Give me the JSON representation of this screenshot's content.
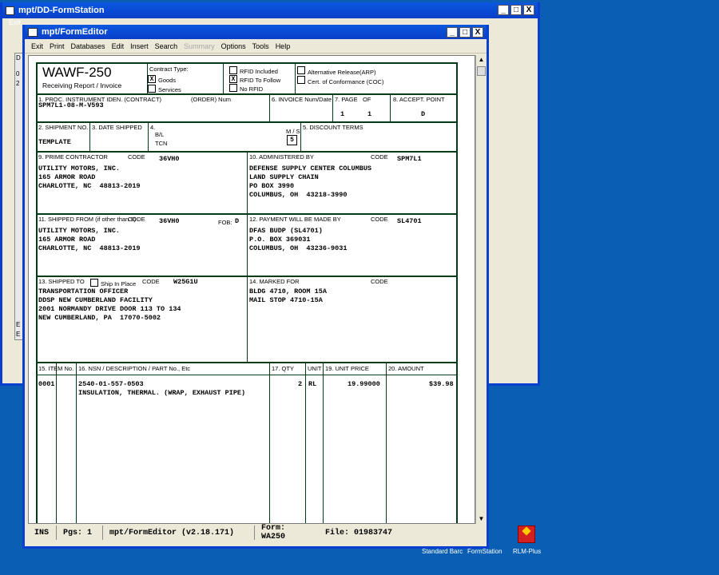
{
  "back_window": {
    "title": "mpt/DD-FormStation",
    "menu_text": "Exit",
    "stub_chars": [
      "D",
      "0",
      "2"
    ],
    "stub_bottom": [
      "E",
      "E"
    ]
  },
  "window": {
    "title": "mpt/FormEditor",
    "minimize": "_",
    "maximize": "□",
    "close": "X"
  },
  "menu": [
    {
      "label": "Exit",
      "disabled": false
    },
    {
      "label": "Print",
      "disabled": false
    },
    {
      "label": "Databases",
      "disabled": false
    },
    {
      "label": "Edit",
      "disabled": false
    },
    {
      "label": "Insert",
      "disabled": false
    },
    {
      "label": "Search",
      "disabled": false
    },
    {
      "label": "Summary",
      "disabled": true
    },
    {
      "label": "Options",
      "disabled": false
    },
    {
      "label": "Tools",
      "disabled": false
    },
    {
      "label": "Help",
      "disabled": false
    }
  ],
  "form": {
    "title": "WAWF-250",
    "subtitle": "Receiving Report / Invoice",
    "contract_type_label": "Contract Type:",
    "goods_label": "Goods",
    "goods_mark": "X",
    "services_label": "Services",
    "rfid_included": "RFID Included",
    "rfid_to_follow": "RFID To Follow",
    "rfid_to_follow_mark": "X",
    "no_rfid": "No RFID",
    "arp_label": "Alternative Release(ARP)",
    "coc_label": "Cert. of Conformance (COC)",
    "f1_label": "1. PROC. INSTRUMENT IDEN. (CONTRACT)",
    "f1_order_label": "(ORDER) Num",
    "f1_value": "SPM7L1-08-M-V593",
    "f6_label": "6. INVOICE Num/Date",
    "f7_label": "7. PAGE",
    "f7_of_label": "OF",
    "f7_page": "1",
    "f7_of": "1",
    "f8_label": "8. ACCEPT. POINT",
    "f8_value": "D",
    "f2_label": "2. SHIPMENT NO.",
    "f2_value": "TEMPLATE",
    "f3_label": "3. DATE SHIPPED",
    "f4_label": "4.",
    "f4_bl": "B/L",
    "f4_tcn": "TCN",
    "f4_ms": "M / S",
    "f4_ms_value": "5",
    "f5_label": "5. DISCOUNT TERMS",
    "f9_label": "9. PRIME CONTRACTOR",
    "code_label": "CODE",
    "f9_code": "36VH0",
    "f9_lines": [
      "UTILITY MOTORS, INC.",
      "165 ARMOR ROAD",
      "CHARLOTTE, NC  48813-2019"
    ],
    "f10_label": "10. ADMINISTERED BY",
    "f10_code": "SPM7L1",
    "f10_lines": [
      "DEFENSE SUPPLY CENTER COLUMBUS",
      "LAND SUPPLY CHAIN",
      "PO BOX 3990",
      "COLUMBUS, OH  43218-3990"
    ],
    "f11_label": "11. SHIPPED FROM (if other than 9)",
    "f11_code": "36VH0",
    "f11_fob_label": "FOB:",
    "f11_fob": "D",
    "f11_lines": [
      "UTILITY MOTORS, INC.",
      "165 ARMOR ROAD",
      "CHARLOTTE, NC  48813-2019"
    ],
    "f12_label": "12. PAYMENT WILL BE MADE BY",
    "f12_code": "SL4701",
    "f12_lines": [
      "DFAS BUDP (SL4701)",
      "P.O. BOX 369031",
      "COLUMBUS, OH  43236-9031"
    ],
    "f13_label": "13. SHIPPED TO",
    "f13_ship_in_place": "Ship In Place",
    "f13_code": "W25G1U",
    "f13_lines": [
      "TRANSPORTATION OFFICER",
      "DDSP NEW CUMBERLAND FACILITY",
      "2001 NORMANDY DRIVE DOOR 113 TO 134",
      "NEW CUMBERLAND, PA  17070-5002"
    ],
    "f14_label": "14. MARKED FOR",
    "f14_lines": [
      "BLDG 4710, ROOM 15A",
      "MAIL STOP 4710-15A"
    ],
    "f15_label": "15. ITEM No.",
    "f16_label": "16. NSN / DESCRIPTION / PART No., Etc",
    "f17_label": "17. QTY",
    "f18_label": "UNIT",
    "f19_label": "19. UNIT PRICE",
    "f20_label": "20. AMOUNT",
    "item": {
      "no": "0001",
      "nsn": "2540-01-557-0503",
      "desc": "INSULATION, THERMAL. (WRAP, EXHAUST PIPE)",
      "qty": "2",
      "unit": "RL",
      "price": "19.99000",
      "amount": "$39.98"
    }
  },
  "status": {
    "mode": "INS",
    "pages": "Pgs: 1",
    "app": "mpt/FormEditor  (v2.18.171)",
    "form": "Form:  WA250",
    "file": "File:  01983747"
  },
  "desktop": {
    "icon_label_1": "Standard Barc",
    "icon_label_2": "FormStation",
    "icon_label_3": "RLM-Plus"
  }
}
